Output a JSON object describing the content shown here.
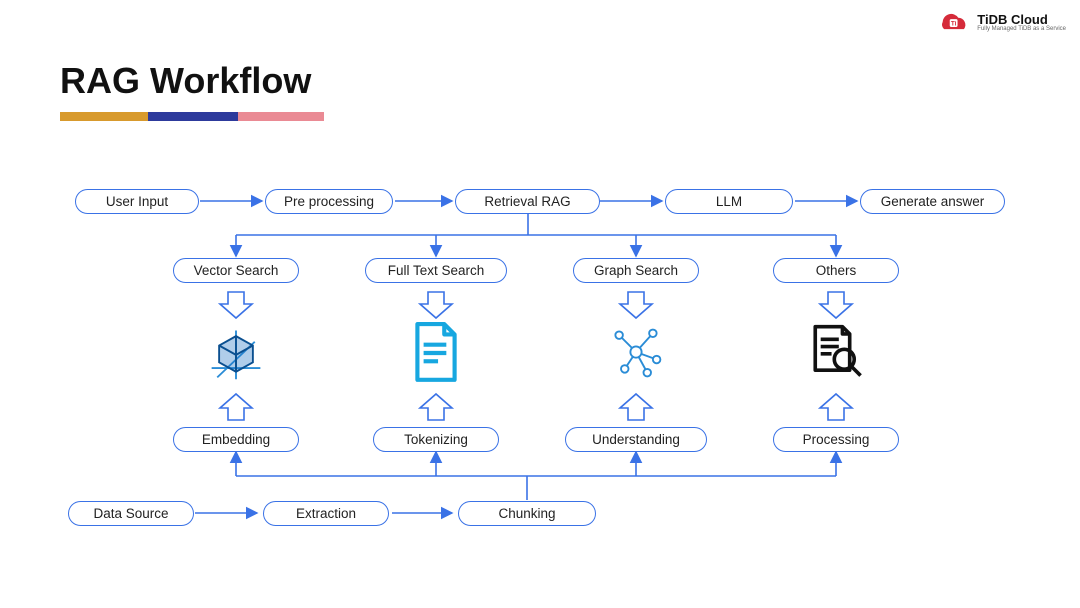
{
  "branding": {
    "name": "TiDB Cloud",
    "tagline": "Fully Managed TiDB as a Service"
  },
  "title": "RAG Workflow",
  "topRow": {
    "userInput": "User Input",
    "preProc": "Pre processing",
    "retrieval": "Retrieval RAG",
    "llm": "LLM",
    "generate": "Generate answer"
  },
  "retrievalMethods": {
    "vector": "Vector Search",
    "fulltext": "Full Text Search",
    "graph": "Graph Search",
    "others": "Others"
  },
  "processing": {
    "embedding": "Embedding",
    "tokenizing": "Tokenizing",
    "understanding": "Understanding",
    "processing": "Processing"
  },
  "bottomRow": {
    "source": "Data Source",
    "extract": "Extraction",
    "chunk": "Chunking"
  },
  "icons": {
    "embedding": "cube-3d",
    "tokenizing": "text-document",
    "understanding": "graph-nodes",
    "processing": "document-search"
  },
  "colors": {
    "pillBorder": "#3a72e6",
    "arrow": "#3a72e6",
    "accentA": "#d89a2d",
    "accentB": "#2d3a9c",
    "accentC": "#ea8a94",
    "iconDoc": "#17a7e0",
    "iconBlack": "#111111"
  }
}
